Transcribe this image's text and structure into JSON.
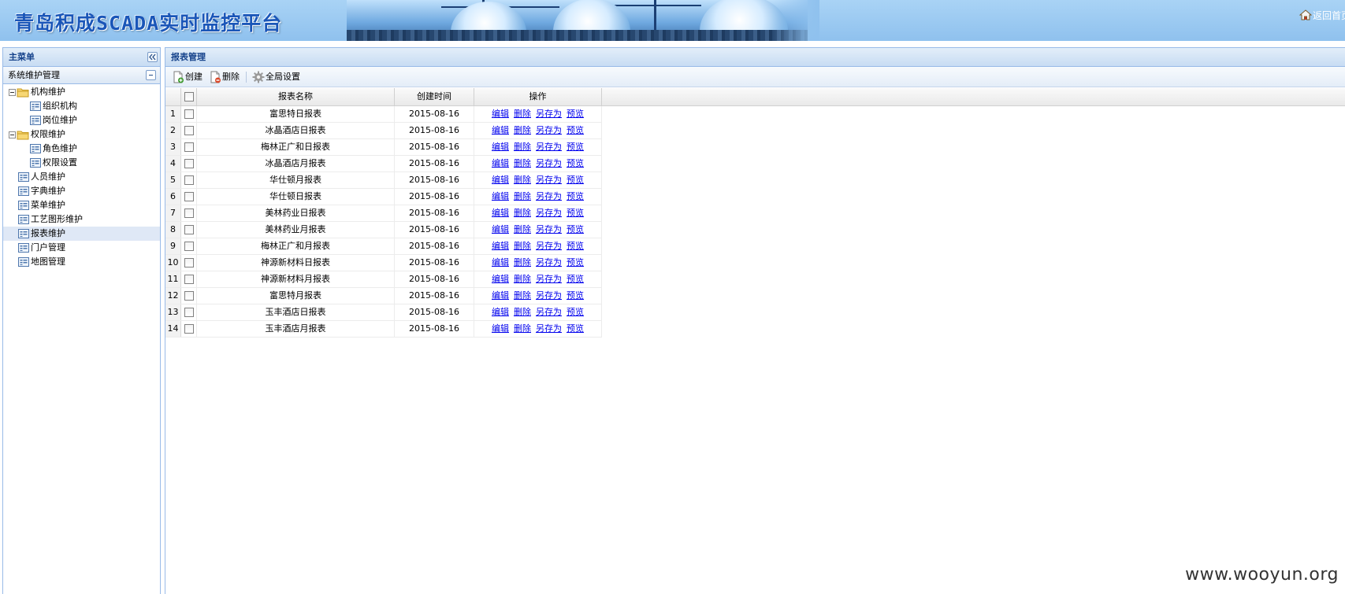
{
  "header": {
    "title": "青岛积成SCADA实时监控平台",
    "home_link": "返回首页"
  },
  "left_menu": {
    "title": "主菜单",
    "section": "系统维护管理",
    "tree": [
      {
        "label": "机构维护",
        "type": "folder",
        "expanded": true,
        "level": 0
      },
      {
        "label": "组织机构",
        "type": "leaf",
        "level": 1
      },
      {
        "label": "岗位维护",
        "type": "leaf",
        "level": 1
      },
      {
        "label": "权限维护",
        "type": "folder",
        "expanded": true,
        "level": 0
      },
      {
        "label": "角色维护",
        "type": "leaf",
        "level": 1
      },
      {
        "label": "权限设置",
        "type": "leaf",
        "level": 1
      },
      {
        "label": "人员维护",
        "type": "leaf",
        "level": 0
      },
      {
        "label": "字典维护",
        "type": "leaf",
        "level": 0
      },
      {
        "label": "菜单维护",
        "type": "leaf",
        "level": 0
      },
      {
        "label": "工艺图形维护",
        "type": "leaf",
        "level": 0
      },
      {
        "label": "报表维护",
        "type": "leaf",
        "level": 0,
        "selected": true
      },
      {
        "label": "门户管理",
        "type": "leaf",
        "level": 0
      },
      {
        "label": "地图管理",
        "type": "leaf",
        "level": 0
      }
    ]
  },
  "main": {
    "title": "报表管理",
    "toolbar": {
      "create_label": "创建",
      "delete_label": "删除",
      "settings_label": "全局设置"
    },
    "grid": {
      "columns": [
        "报表名称",
        "创建时间",
        "操作"
      ],
      "actions": [
        "编辑",
        "删除",
        "另存为",
        "预览"
      ],
      "rows": [
        {
          "num": "1",
          "name": "富思特日报表",
          "date": "2015-08-16"
        },
        {
          "num": "2",
          "name": "冰晶酒店日报表",
          "date": "2015-08-16"
        },
        {
          "num": "3",
          "name": "梅林正广和日报表",
          "date": "2015-08-16"
        },
        {
          "num": "4",
          "name": "冰晶酒店月报表",
          "date": "2015-08-16"
        },
        {
          "num": "5",
          "name": "华仕顿月报表",
          "date": "2015-08-16"
        },
        {
          "num": "6",
          "name": "华仕顿日报表",
          "date": "2015-08-16"
        },
        {
          "num": "7",
          "name": "美林药业日报表",
          "date": "2015-08-16"
        },
        {
          "num": "8",
          "name": "美林药业月报表",
          "date": "2015-08-16"
        },
        {
          "num": "9",
          "name": "梅林正广和月报表",
          "date": "2015-08-16"
        },
        {
          "num": "10",
          "name": "神源新材料日报表",
          "date": "2015-08-16"
        },
        {
          "num": "11",
          "name": "神源新材料月报表",
          "date": "2015-08-16"
        },
        {
          "num": "12",
          "name": "富思特月报表",
          "date": "2015-08-16"
        },
        {
          "num": "13",
          "name": "玉丰酒店日报表",
          "date": "2015-08-16"
        },
        {
          "num": "14",
          "name": "玉丰酒店月报表",
          "date": "2015-08-16"
        }
      ]
    }
  },
  "watermark": "www.wooyun.org",
  "colors": {
    "panel_title": "#15428b",
    "border": "#99bbe8",
    "link": "#0000ee",
    "selected_row": "#dfe8f6"
  }
}
